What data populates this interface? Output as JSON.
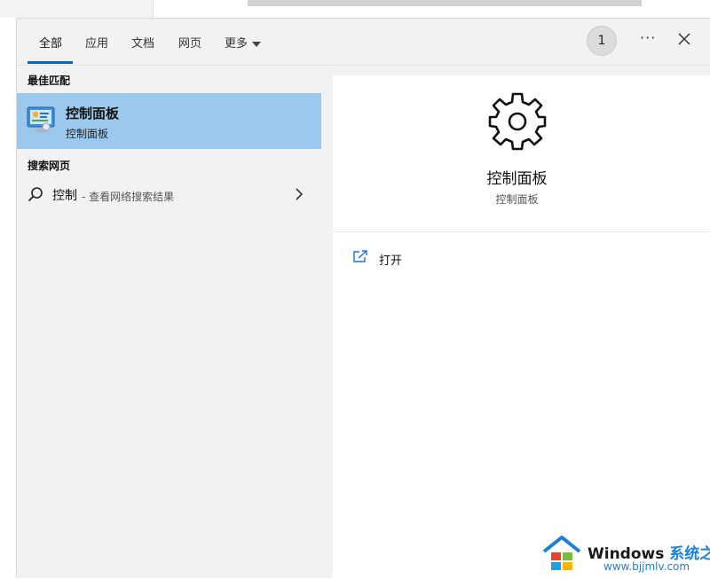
{
  "tabs": [
    {
      "label": "全部",
      "active": true
    },
    {
      "label": "应用",
      "active": false
    },
    {
      "label": "文档",
      "active": false
    },
    {
      "label": "网页",
      "active": false
    },
    {
      "label": "更多",
      "active": false
    }
  ],
  "header": {
    "badge_count": "1",
    "more_options": "···"
  },
  "results": {
    "best_match_heading": "最佳匹配",
    "best_match": {
      "title": "控制面板",
      "subtitle": "控制面板",
      "icon": "control-panel-icon"
    },
    "web_heading": "搜索网页",
    "web_item": {
      "query": "控制",
      "hint": "- 查看网络搜索结果"
    }
  },
  "detail": {
    "icon": "gear-icon",
    "title": "控制面板",
    "subtitle": "控制面板",
    "actions": [
      {
        "label": "打开",
        "icon": "open-icon"
      }
    ]
  },
  "watermark": {
    "brand": "Windows",
    "brand_cn": "系统之家",
    "url": "www.bjjmlv.com"
  },
  "colors": {
    "accent": "#0a63c9",
    "selected_bg": "#9bc9ee",
    "panel_bg": "#f2f2f2"
  }
}
